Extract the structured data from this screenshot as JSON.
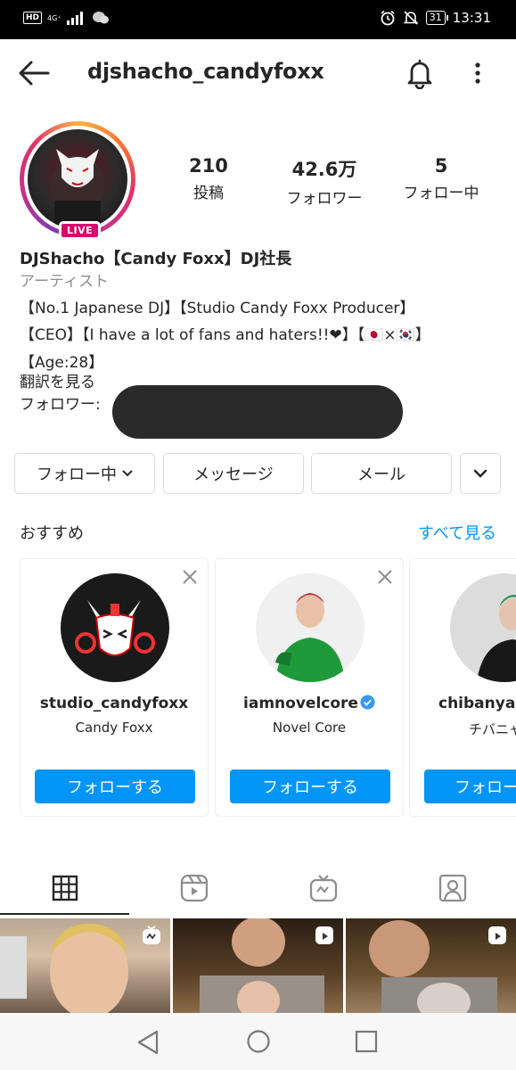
{
  "status_bar": {
    "hd": "HD",
    "network": "4G⁺",
    "battery": "31",
    "time": "13:31"
  },
  "header": {
    "username": "djshacho_candyfoxx"
  },
  "profile": {
    "live_label": "LIVE",
    "stats": [
      {
        "value": "210",
        "label": "投稿"
      },
      {
        "value": "42.6万",
        "label": "フォロワー"
      },
      {
        "value": "5",
        "label": "フォロー中"
      }
    ]
  },
  "bio": {
    "name": "DJShacho【Candy Foxx】DJ社長",
    "category": "アーティスト",
    "line1": "【No.1 Japanese DJ】【Studio Candy Foxx Producer】",
    "line2": "【CEO】【I have a lot of fans and haters!!❤】【🇯🇵×🇰🇷】",
    "line3": "【Age:28】",
    "translate": "翻訳を見る",
    "followers_label": "フォロワー:"
  },
  "actions": {
    "following": "フォロー中",
    "message": "メッセージ",
    "mail": "メール"
  },
  "suggestions": {
    "title": "おすすめ",
    "see_all": "すべて見る",
    "cards": [
      {
        "username": "studio_candyfoxx",
        "name": "Candy Foxx",
        "button": "フォローする"
      },
      {
        "username": "iamnovelcore",
        "name": "Novel Core",
        "button": "フォローする",
        "verified": true
      },
      {
        "username": "chibanyan",
        "name": "チバニャ",
        "button": "フォロー"
      }
    ]
  },
  "colors": {
    "accent_blue": "#0095f6",
    "live_pink": "#d6086e",
    "text": "#262626",
    "muted": "#8e8e8e"
  }
}
